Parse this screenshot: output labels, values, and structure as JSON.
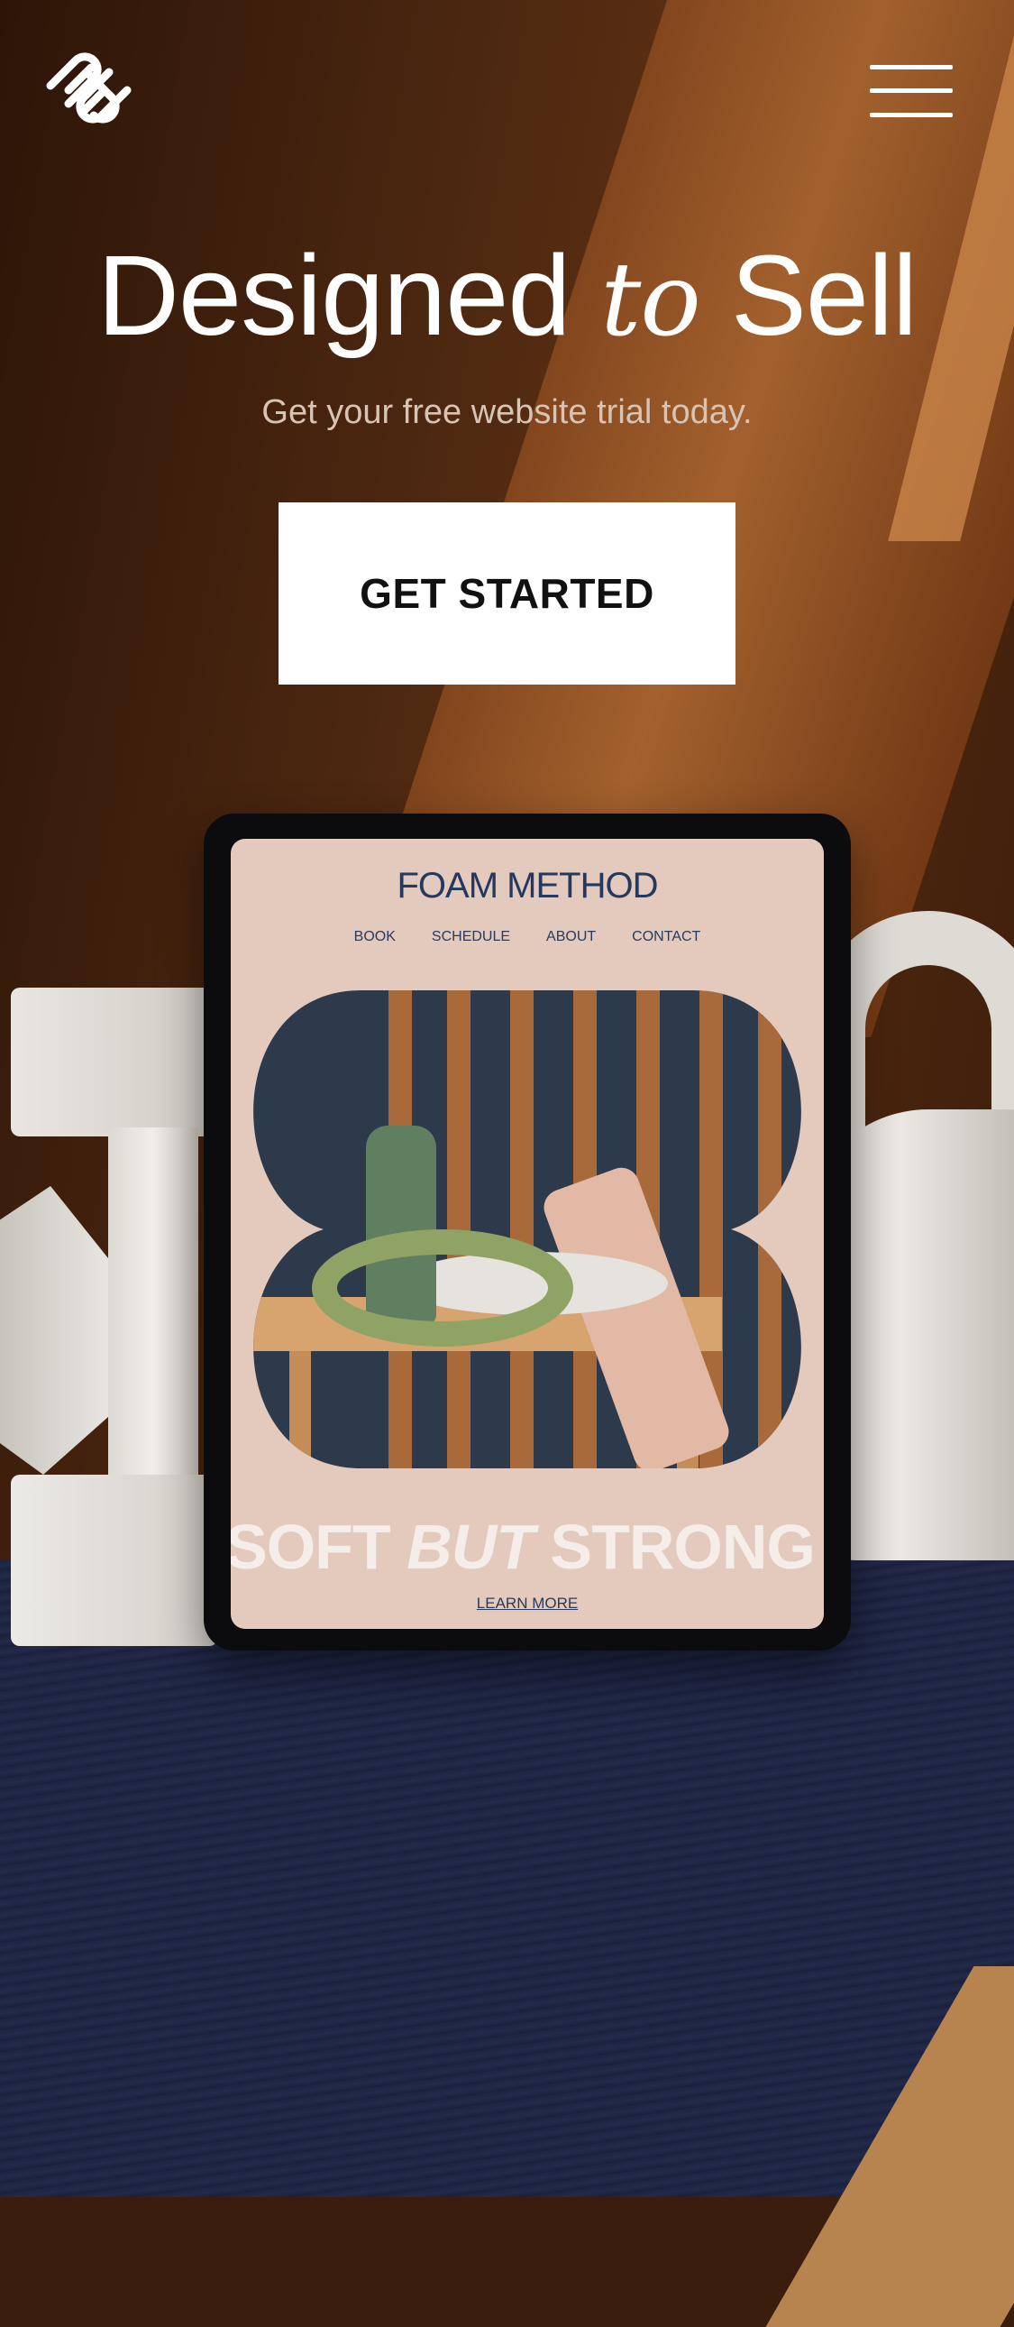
{
  "header": {
    "logo_icon": "squarespace-logo-icon",
    "menu_icon": "hamburger-menu-icon"
  },
  "hero": {
    "title_part1": "Designed ",
    "title_italic": "to",
    "title_part2": " Sell",
    "subtitle": "Get your free website trial today.",
    "cta_label": "GET STARTED"
  },
  "tablet_site": {
    "title": "FOAM METHOD",
    "nav": [
      "BOOK",
      "SCHEDULE",
      "ABOUT",
      "CONTACT"
    ],
    "tagline_part1": "SOFT ",
    "tagline_italic": "BUT",
    "tagline_part2": " STRONG",
    "learn_more": "LEARN MORE"
  },
  "colors": {
    "cta_bg": "#ffffff",
    "hero_text": "#ffffff",
    "site_accent": "#24395f",
    "screen_bg": "#e4c9bd"
  }
}
